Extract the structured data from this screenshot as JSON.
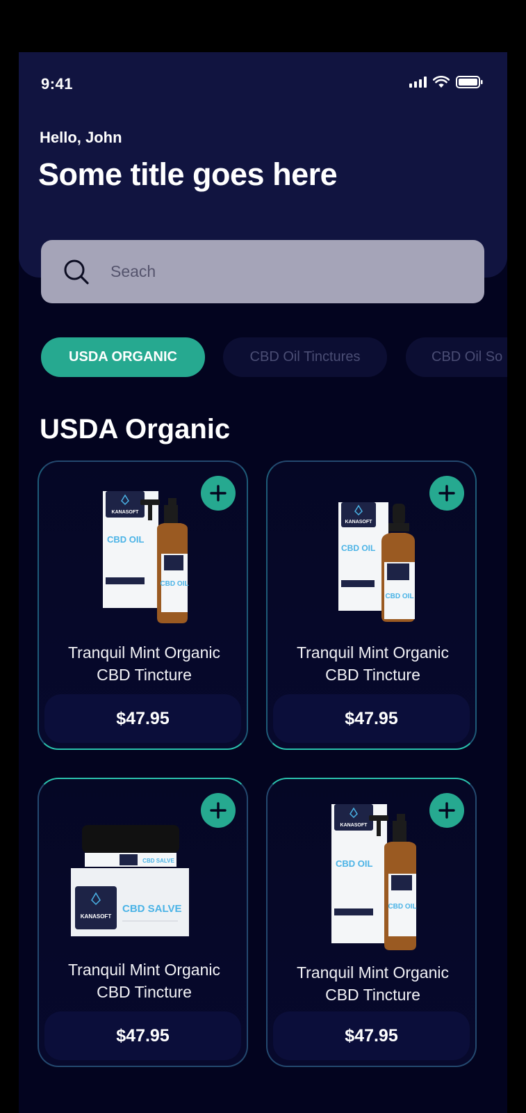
{
  "status_bar": {
    "time": "9:41"
  },
  "header": {
    "greeting": "Hello, John",
    "title": "Some title goes here"
  },
  "search": {
    "placeholder": "Seach"
  },
  "chips": [
    {
      "label": "USDA ORGANIC",
      "active": true
    },
    {
      "label": "CBD Oil Tinctures",
      "active": false
    },
    {
      "label": "CBD Oil So",
      "active": false
    }
  ],
  "section": {
    "title": "USDA Organic"
  },
  "products": [
    {
      "name_line1": "Tranquil Mint Organic",
      "name_line2": "CBD Tincture",
      "price": "$47.95",
      "image": "cbd-oil-pump-bottle",
      "brand": "KANASOFT",
      "label": "CBD OIL"
    },
    {
      "name_line1": "Tranquil Mint Organic",
      "name_line2": "CBD Tincture",
      "price": "$47.95",
      "image": "cbd-oil-dropper-bottle",
      "brand": "KANASOFT",
      "label": "CBD OIL"
    },
    {
      "name_line1": "Tranquil Mint Organic",
      "name_line2": "CBD Tincture",
      "price": "$47.95",
      "image": "cbd-salve-jar",
      "brand": "KANASOFT",
      "label": "CBD SALVE"
    },
    {
      "name_line1": "Tranquil Mint Organic",
      "name_line2": "CBD Tincture",
      "price": "$47.95",
      "image": "cbd-oil-pump-bottle",
      "brand": "KANASOFT",
      "label": "CBD OIL"
    }
  ],
  "colors": {
    "accent": "#26a990",
    "background": "#03041f",
    "header": "#111440",
    "search": "#a5a4b8"
  }
}
